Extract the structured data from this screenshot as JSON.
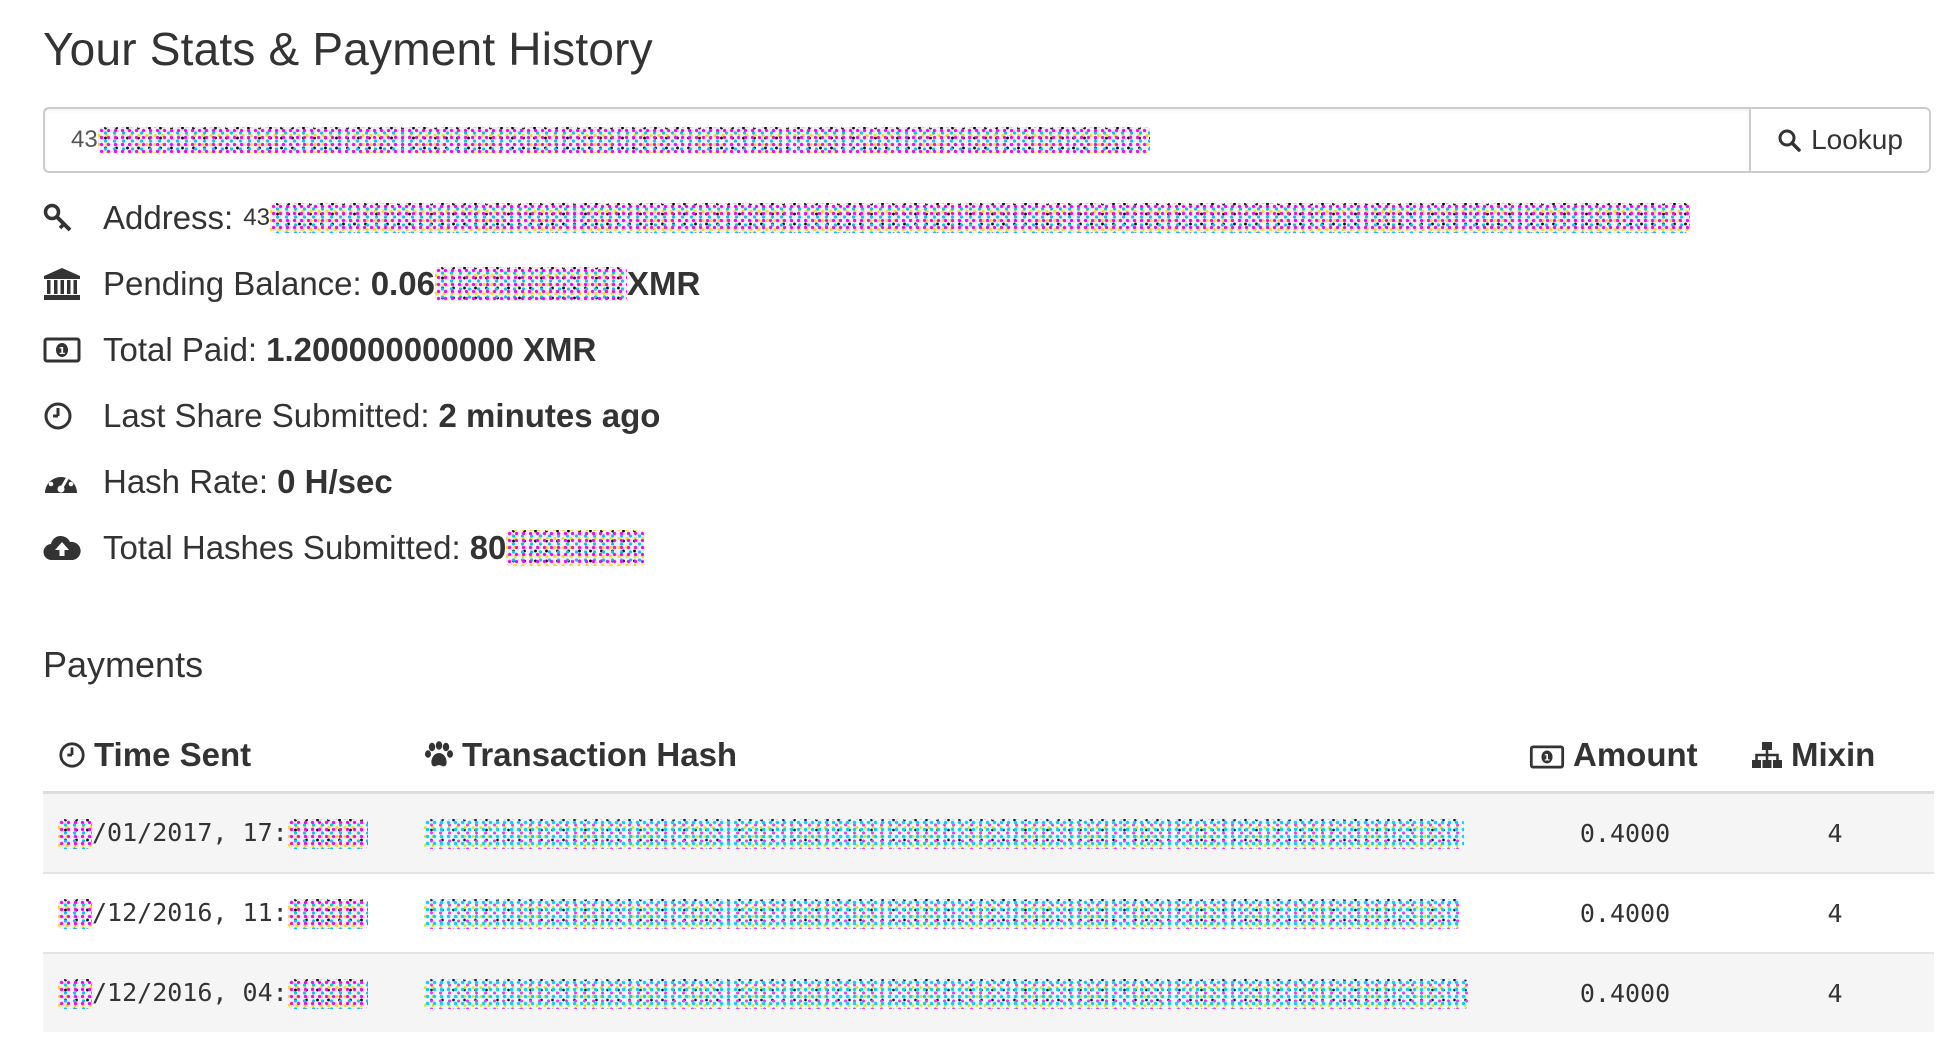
{
  "page": {
    "title": "Your Stats & Payment History"
  },
  "lookup": {
    "address_prefix": "43",
    "button_label": "Lookup",
    "button_icon": "search-icon"
  },
  "stats": [
    {
      "icon": "key-icon",
      "label": "Address:",
      "value": "43"
    },
    {
      "icon": "bank-icon",
      "label": "Pending Balance:",
      "value": "0.06",
      "suffix": "XMR"
    },
    {
      "icon": "money-icon",
      "label": "Total Paid:",
      "value": "1.200000000000 XMR"
    },
    {
      "icon": "clock-icon",
      "label": "Last Share Submitted:",
      "value": "2 minutes ago"
    },
    {
      "icon": "dashboard-icon",
      "label": "Hash Rate:",
      "value": "0 H/sec"
    },
    {
      "icon": "cloud-upload-icon",
      "label": "Total Hashes Submitted:",
      "value": "80"
    }
  ],
  "payments": {
    "heading": "Payments",
    "columns": [
      {
        "label": "Time Sent",
        "icon": "clock-icon"
      },
      {
        "label": "Transaction Hash",
        "icon": "paw-icon"
      },
      {
        "label": "Amount",
        "icon": "money-icon"
      },
      {
        "label": "Mixin",
        "icon": "sitemap-icon"
      }
    ],
    "rows": [
      {
        "time_mid": "/01/2017, 17:",
        "amount": "0.4000",
        "mixin": "4"
      },
      {
        "time_mid": "/12/2016, 11:",
        "amount": "0.4000",
        "mixin": "4"
      },
      {
        "time_mid": "/12/2016, 04:",
        "amount": "0.4000",
        "mixin": "4"
      }
    ]
  },
  "colors": {
    "text": "#333333",
    "border": "#cccccc",
    "row_stripe": "#f5f5f5"
  }
}
